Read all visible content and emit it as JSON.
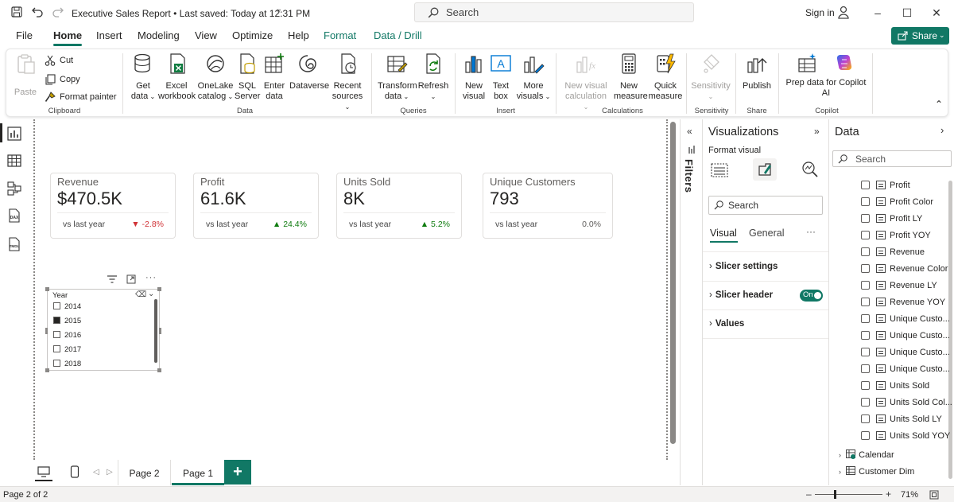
{
  "titlebar": {
    "title": "Executive Sales Report • Last saved: Today at 12:31 PM",
    "search_placeholder": "Search",
    "signin": "Sign in"
  },
  "menu": {
    "tabs": [
      "File",
      "Home",
      "Insert",
      "Modeling",
      "View",
      "Optimize",
      "Help",
      "Format",
      "Data / Drill"
    ],
    "active": "Home",
    "share": "Share"
  },
  "ribbon": {
    "clipboard": {
      "paste": "Paste",
      "cut": "Cut",
      "copy": "Copy",
      "format_painter": "Format painter",
      "label": "Clipboard"
    },
    "data": {
      "get_data": [
        "Get",
        "data"
      ],
      "excel": [
        "Excel",
        "workbook"
      ],
      "onelake": [
        "OneLake",
        "catalog"
      ],
      "sql": [
        "SQL",
        "Server"
      ],
      "enter": [
        "Enter",
        "data"
      ],
      "dataverse": "Dataverse",
      "recent": [
        "Recent",
        "sources"
      ],
      "label": "Data"
    },
    "queries": {
      "transform": [
        "Transform",
        "data"
      ],
      "refresh": "Refresh",
      "label": "Queries"
    },
    "insert": {
      "new_visual": [
        "New",
        "visual"
      ],
      "text_box": [
        "Text",
        "box"
      ],
      "more_visuals": [
        "More",
        "visuals"
      ],
      "label": "Insert"
    },
    "calculations": {
      "new_visual_calc": [
        "New visual",
        "calculation"
      ],
      "new_measure": [
        "New",
        "measure"
      ],
      "quick_measure": [
        "Quick",
        "measure"
      ],
      "label": "Calculations"
    },
    "sensitivity": {
      "btn": "Sensitivity",
      "label": "Sensitivity"
    },
    "share": {
      "publish": "Publish",
      "label": "Share"
    },
    "copilot": {
      "prep": [
        "Prep data for Copilot",
        "AI"
      ],
      "label": "Copilot"
    }
  },
  "cards": [
    {
      "label": "Revenue",
      "value": "$470.5K",
      "compare": "vs last year",
      "delta": "▼ -2.8%",
      "delta_color": "#d13438"
    },
    {
      "label": "Profit",
      "value": "61.6K",
      "compare": "vs last year",
      "delta": "▲ 24.4%",
      "delta_color": "#107c10"
    },
    {
      "label": "Units Sold",
      "value": "8K",
      "compare": "vs last year",
      "delta": "▲ 5.2%",
      "delta_color": "#107c10"
    },
    {
      "label": "Unique Customers",
      "value": "793",
      "compare": "vs last year",
      "delta": "0.0%",
      "delta_color": "#605e5c"
    }
  ],
  "slicer": {
    "title": "Year",
    "items": [
      {
        "label": "2014",
        "checked": false
      },
      {
        "label": "2015",
        "checked": true
      },
      {
        "label": "2016",
        "checked": false
      },
      {
        "label": "2017",
        "checked": false
      },
      {
        "label": "2018",
        "checked": false
      }
    ]
  },
  "pages": {
    "tabs": [
      "Page 2",
      "Page 1"
    ],
    "active": "Page 1",
    "add": "+"
  },
  "filters": {
    "title": "Filters"
  },
  "visualizations": {
    "title": "Visualizations",
    "format_visual": "Format visual",
    "search_placeholder": "Search",
    "tab_visual": "Visual",
    "tab_general": "General",
    "more": "···",
    "sections": [
      "Slicer settings",
      "Slicer header",
      "Values"
    ],
    "toggle": "On"
  },
  "data_pane": {
    "title": "Data",
    "search_placeholder": "Search",
    "fields": [
      "Profit",
      "Profit Color",
      "Profit LY",
      "Profit YOY",
      "Revenue",
      "Revenue Color",
      "Revenue LY",
      "Revenue YOY",
      "Unique Custo...",
      "Unique Custo...",
      "Unique Custo...",
      "Unique Custo...",
      "Units Sold",
      "Units Sold Col...",
      "Units Sold LY",
      "Units Sold YOY"
    ],
    "tables": [
      "Calendar",
      "Customer Dim"
    ]
  },
  "statusbar": {
    "page": "Page 2 of 2",
    "zoom": "71%"
  }
}
